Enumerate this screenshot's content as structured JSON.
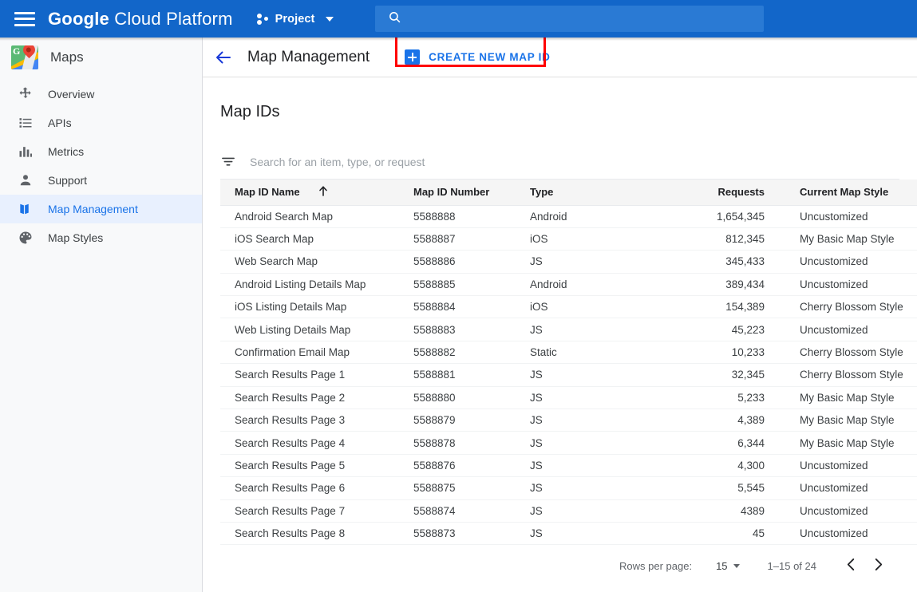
{
  "topbar": {
    "menu_icon": "hamburger-menu-icon",
    "brand_first": "Google",
    "brand_rest": "Cloud Platform",
    "project_label": "Project",
    "project_icon": "project-dots-icon",
    "dropdown_icon": "chevron-down-icon",
    "search": {
      "icon": "search-icon",
      "value": "",
      "placeholder": ""
    }
  },
  "sidebar": {
    "product_name": "Maps",
    "product_icon": "google-maps-logo",
    "items": [
      {
        "label": "Overview",
        "icon": "overview-icon",
        "active": false
      },
      {
        "label": "APIs",
        "icon": "list-icon",
        "active": false
      },
      {
        "label": "Metrics",
        "icon": "bar-chart-icon",
        "active": false
      },
      {
        "label": "Support",
        "icon": "person-icon",
        "active": false
      },
      {
        "label": "Map Management",
        "icon": "map-icon",
        "active": true
      },
      {
        "label": "Map Styles",
        "icon": "palette-icon",
        "active": false
      }
    ]
  },
  "page": {
    "back_icon": "back-arrow-icon",
    "title": "Map Management",
    "create_button_label": "CREATE NEW MAP ID",
    "create_button_icon": "plus-square-icon",
    "annotation_color": "#ff0000",
    "accent_color": "#1a73e8"
  },
  "main": {
    "section_title": "Map IDs",
    "filter": {
      "icon": "filter-list-icon",
      "value": "",
      "placeholder": "Search for an item, type, or request"
    },
    "table": {
      "columns": [
        {
          "label": "Map ID Name",
          "align": "left",
          "sorted": true,
          "sort_icon": "sort-ascending-arrow"
        },
        {
          "label": "Map ID Number",
          "align": "left",
          "sorted": false
        },
        {
          "label": "Type",
          "align": "left",
          "sorted": false
        },
        {
          "label": "Requests",
          "align": "right",
          "sorted": false
        },
        {
          "label": "Current Map Style",
          "align": "left",
          "sorted": false
        }
      ],
      "rows": [
        {
          "name": "Android Search Map",
          "number": "5588888",
          "type": "Android",
          "requests": "1,654,345",
          "style": "Uncustomized"
        },
        {
          "name": "iOS Search Map",
          "number": "5588887",
          "type": "iOS",
          "requests": "812,345",
          "style": "My Basic Map Style"
        },
        {
          "name": "Web Search Map",
          "number": "5588886",
          "type": "JS",
          "requests": "345,433",
          "style": "Uncustomized"
        },
        {
          "name": "Android Listing Details Map",
          "number": "5588885",
          "type": "Android",
          "requests": "389,434",
          "style": "Uncustomized"
        },
        {
          "name": "iOS Listing Details Map",
          "number": "5588884",
          "type": "iOS",
          "requests": "154,389",
          "style": "Cherry Blossom Style"
        },
        {
          "name": "Web Listing Details Map",
          "number": "5588883",
          "type": "JS",
          "requests": "45,223",
          "style": "Uncustomized"
        },
        {
          "name": "Confirmation Email Map",
          "number": "5588882",
          "type": "Static",
          "requests": "10,233",
          "style": "Cherry Blossom Style"
        },
        {
          "name": "Search Results Page 1",
          "number": "5588881",
          "type": "JS",
          "requests": "32,345",
          "style": "Cherry Blossom Style"
        },
        {
          "name": "Search Results Page 2",
          "number": "5588880",
          "type": "JS",
          "requests": "5,233",
          "style": "My Basic Map Style"
        },
        {
          "name": "Search Results Page 3",
          "number": "5588879",
          "type": "JS",
          "requests": "4,389",
          "style": "My Basic Map Style"
        },
        {
          "name": "Search Results Page 4",
          "number": "5588878",
          "type": "JS",
          "requests": "6,344",
          "style": "My Basic Map Style"
        },
        {
          "name": "Search Results Page 5",
          "number": "5588876",
          "type": "JS",
          "requests": "4,300",
          "style": "Uncustomized"
        },
        {
          "name": "Search Results Page 6",
          "number": "5588875",
          "type": "JS",
          "requests": "5,545",
          "style": "Uncustomized"
        },
        {
          "name": "Search Results Page 7",
          "number": "5588874",
          "type": "JS",
          "requests": "4389",
          "style": "Uncustomized"
        },
        {
          "name": "Search Results Page 8",
          "number": "5588873",
          "type": "JS",
          "requests": "45",
          "style": "Uncustomized"
        }
      ]
    },
    "pagination": {
      "rows_per_page_label": "Rows per page:",
      "rows_per_page_value": "15",
      "range_label": "1–15 of 24",
      "prev_icon": "chevron-left-icon",
      "next_icon": "chevron-right-icon"
    }
  }
}
